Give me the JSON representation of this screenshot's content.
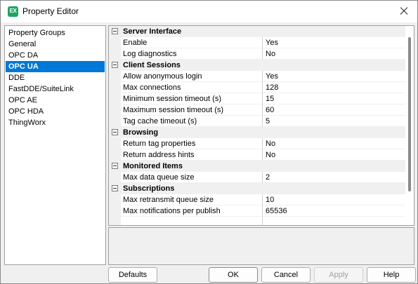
{
  "window": {
    "title": "Property Editor",
    "icon_text": "EX"
  },
  "left_panel": {
    "items": [
      {
        "label": "Property Groups",
        "selected": false
      },
      {
        "label": "General",
        "selected": false
      },
      {
        "label": "OPC DA",
        "selected": false
      },
      {
        "label": "OPC UA",
        "selected": true
      },
      {
        "label": "DDE",
        "selected": false
      },
      {
        "label": "FastDDE/SuiteLink",
        "selected": false
      },
      {
        "label": "OPC AE",
        "selected": false
      },
      {
        "label": "OPC HDA",
        "selected": false
      },
      {
        "label": "ThingWorx",
        "selected": false
      }
    ]
  },
  "property_grid": {
    "categories": [
      {
        "name": "Server Interface",
        "properties": [
          {
            "name": "Enable",
            "value": "Yes"
          },
          {
            "name": "Log diagnostics",
            "value": "No"
          }
        ]
      },
      {
        "name": "Client Sessions",
        "properties": [
          {
            "name": "Allow anonymous login",
            "value": "Yes"
          },
          {
            "name": "Max connections",
            "value": "128"
          },
          {
            "name": "Minimum session timeout (s)",
            "value": "15"
          },
          {
            "name": "Maximum session timeout (s)",
            "value": "60"
          },
          {
            "name": "Tag cache timeout (s)",
            "value": "5"
          }
        ]
      },
      {
        "name": "Browsing",
        "properties": [
          {
            "name": "Return tag properties",
            "value": "No"
          },
          {
            "name": "Return address hints",
            "value": "No"
          }
        ]
      },
      {
        "name": "Monitored Items",
        "properties": [
          {
            "name": "Max data queue size",
            "value": "2"
          }
        ]
      },
      {
        "name": "Subscriptions",
        "properties": [
          {
            "name": "Max retransmit queue size",
            "value": "10"
          },
          {
            "name": "Max notifications per publish",
            "value": "65536"
          }
        ]
      }
    ]
  },
  "buttons": {
    "defaults": "Defaults",
    "ok": "OK",
    "cancel": "Cancel",
    "apply": "Apply",
    "help": "Help"
  },
  "button_states": {
    "apply_enabled": false
  }
}
